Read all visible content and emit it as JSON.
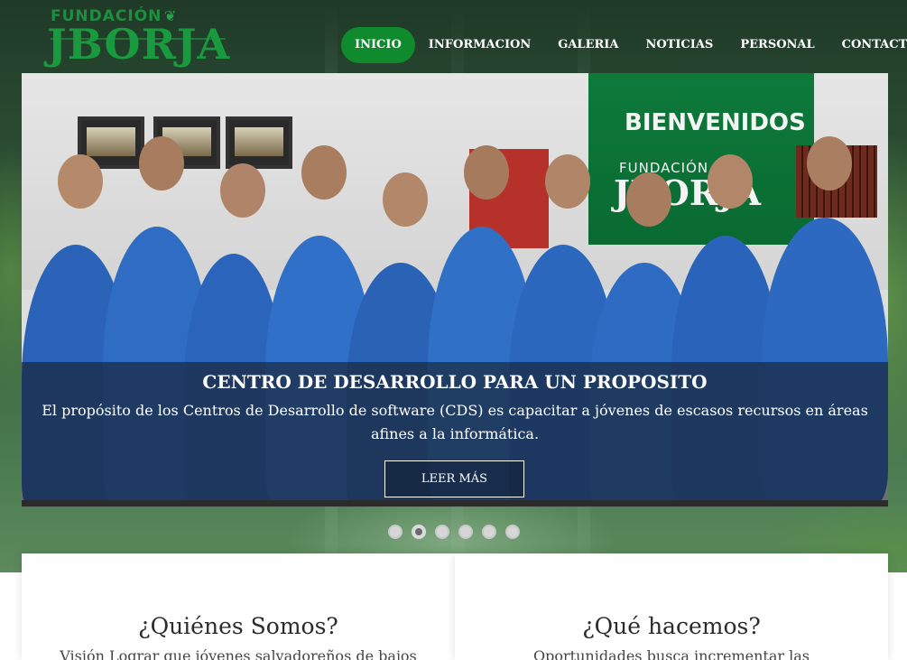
{
  "brand": {
    "logo_top": "FUNDACIÓN",
    "logo_main": "JBORJA"
  },
  "nav": {
    "items": [
      {
        "label": "INICIO",
        "active": true
      },
      {
        "label": "INFORMACION",
        "active": false
      },
      {
        "label": "GALERIA",
        "active": false
      },
      {
        "label": "NOTICIAS",
        "active": false
      },
      {
        "label": "PERSONAL",
        "active": false
      },
      {
        "label": "CONTACTO",
        "active": false
      }
    ],
    "active_color": "#0f8a2c"
  },
  "slider": {
    "banner_text_1": "BIENVENIDOS",
    "banner_text_2": "FUNDACIÓN",
    "banner_text_3": "JBORJA",
    "caption_title": "CENTRO DE DESARROLLO PARA UN PROPOSITO",
    "caption_text": "El propósito de los Centros de Desarrollo de software (CDS) es capacitar a jóvenes de escasos recursos en áreas afines a la informática.",
    "button_label": "LEER MÁS",
    "slide_count": 6,
    "active_slide": 2
  },
  "cards": [
    {
      "title": "¿Quiénes Somos?",
      "text": "Visión Lograr que jóvenes salvadoreños de bajos"
    },
    {
      "title": "¿Qué hacemos?",
      "text": "Oportunidades busca incrementar las"
    }
  ]
}
